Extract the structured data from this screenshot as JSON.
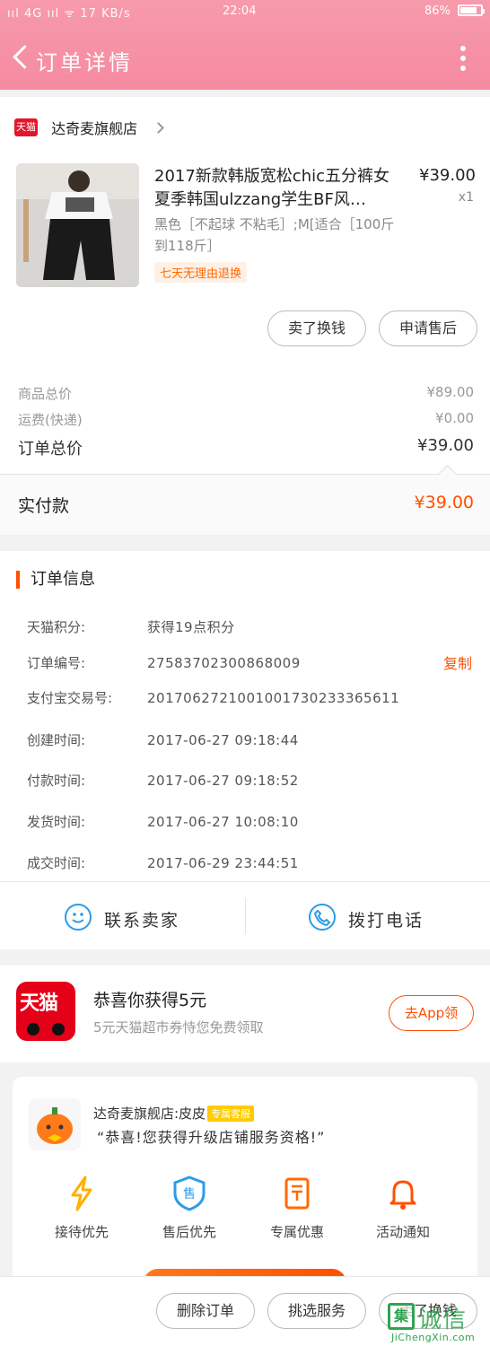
{
  "status_bar": {
    "left": "ııl 4G ııl ᯤ 17 KB/s",
    "time": "22:04",
    "battery_text": "86%"
  },
  "header": {
    "title": "订单详情"
  },
  "shop": {
    "badge": "天猫",
    "name": "达奇麦旗舰店"
  },
  "product": {
    "title": "2017新款韩版宽松chic五分裤女夏季韩国ulzzang学生BF风…",
    "price": "¥39.00",
    "qty": "x1",
    "sku": "黑色［不起球 不粘毛］;M[适合［100斤到118斤］",
    "tag": "七天无理由退换"
  },
  "product_actions": {
    "exchange": "卖了换钱",
    "after_sale": "申请售后"
  },
  "summary": {
    "goods_label": "商品总价",
    "goods_value": "¥89.00",
    "shipping_label": "运费(快递)",
    "shipping_value": "¥0.00",
    "order_total_label": "订单总价",
    "order_total_value": "¥39.00",
    "paid_label": "实付款",
    "paid_value": "¥39.00"
  },
  "order_info": {
    "title": "订单信息",
    "copy": "复制",
    "rows": [
      {
        "k": "天猫积分:",
        "v": "获得19点积分"
      },
      {
        "k": "订单编号:",
        "v": "27583702300868009"
      },
      {
        "k": "支付宝交易号:",
        "v": "2017062721001001730233365611"
      },
      {
        "k": "创建时间:",
        "v": "2017-06-27 09:18:44"
      },
      {
        "k": "付款时间:",
        "v": "2017-06-27 09:18:52"
      },
      {
        "k": "发货时间:",
        "v": "2017-06-27 10:08:10"
      },
      {
        "k": "成交时间:",
        "v": "2017-06-29 23:44:51"
      }
    ]
  },
  "contact": {
    "seller": "联系卖家",
    "call": "拨打电话"
  },
  "promo": {
    "logo_text": "天猫",
    "headline": "恭喜你获得5元",
    "sub": "5元天猫超市券恃您免费领取",
    "button": "去App领"
  },
  "service": {
    "name": "达奇麦旗舰店:皮皮",
    "badge": "专属客服",
    "message": "“恭喜!您获得升级店铺服务资格!”",
    "items": [
      {
        "label": "接待优先",
        "icon": "lightning-icon"
      },
      {
        "label": "售后优先",
        "icon": "shield-sale-icon"
      },
      {
        "label": "专属优惠",
        "icon": "ticket-icon"
      },
      {
        "label": "活动通知",
        "icon": "bell-icon"
      }
    ]
  },
  "bottom": {
    "delete": "删除订单",
    "pick_service": "挑选服务",
    "sell": "卖了换钱"
  },
  "watermark": {
    "big": "诚信",
    "small": "JiChengXin.com",
    "box": "集"
  },
  "colors": {
    "header": "#f58aa1",
    "accent": "#ff5000",
    "tmall_red": "#e50019",
    "contact_blue": "#2c9ce8"
  }
}
